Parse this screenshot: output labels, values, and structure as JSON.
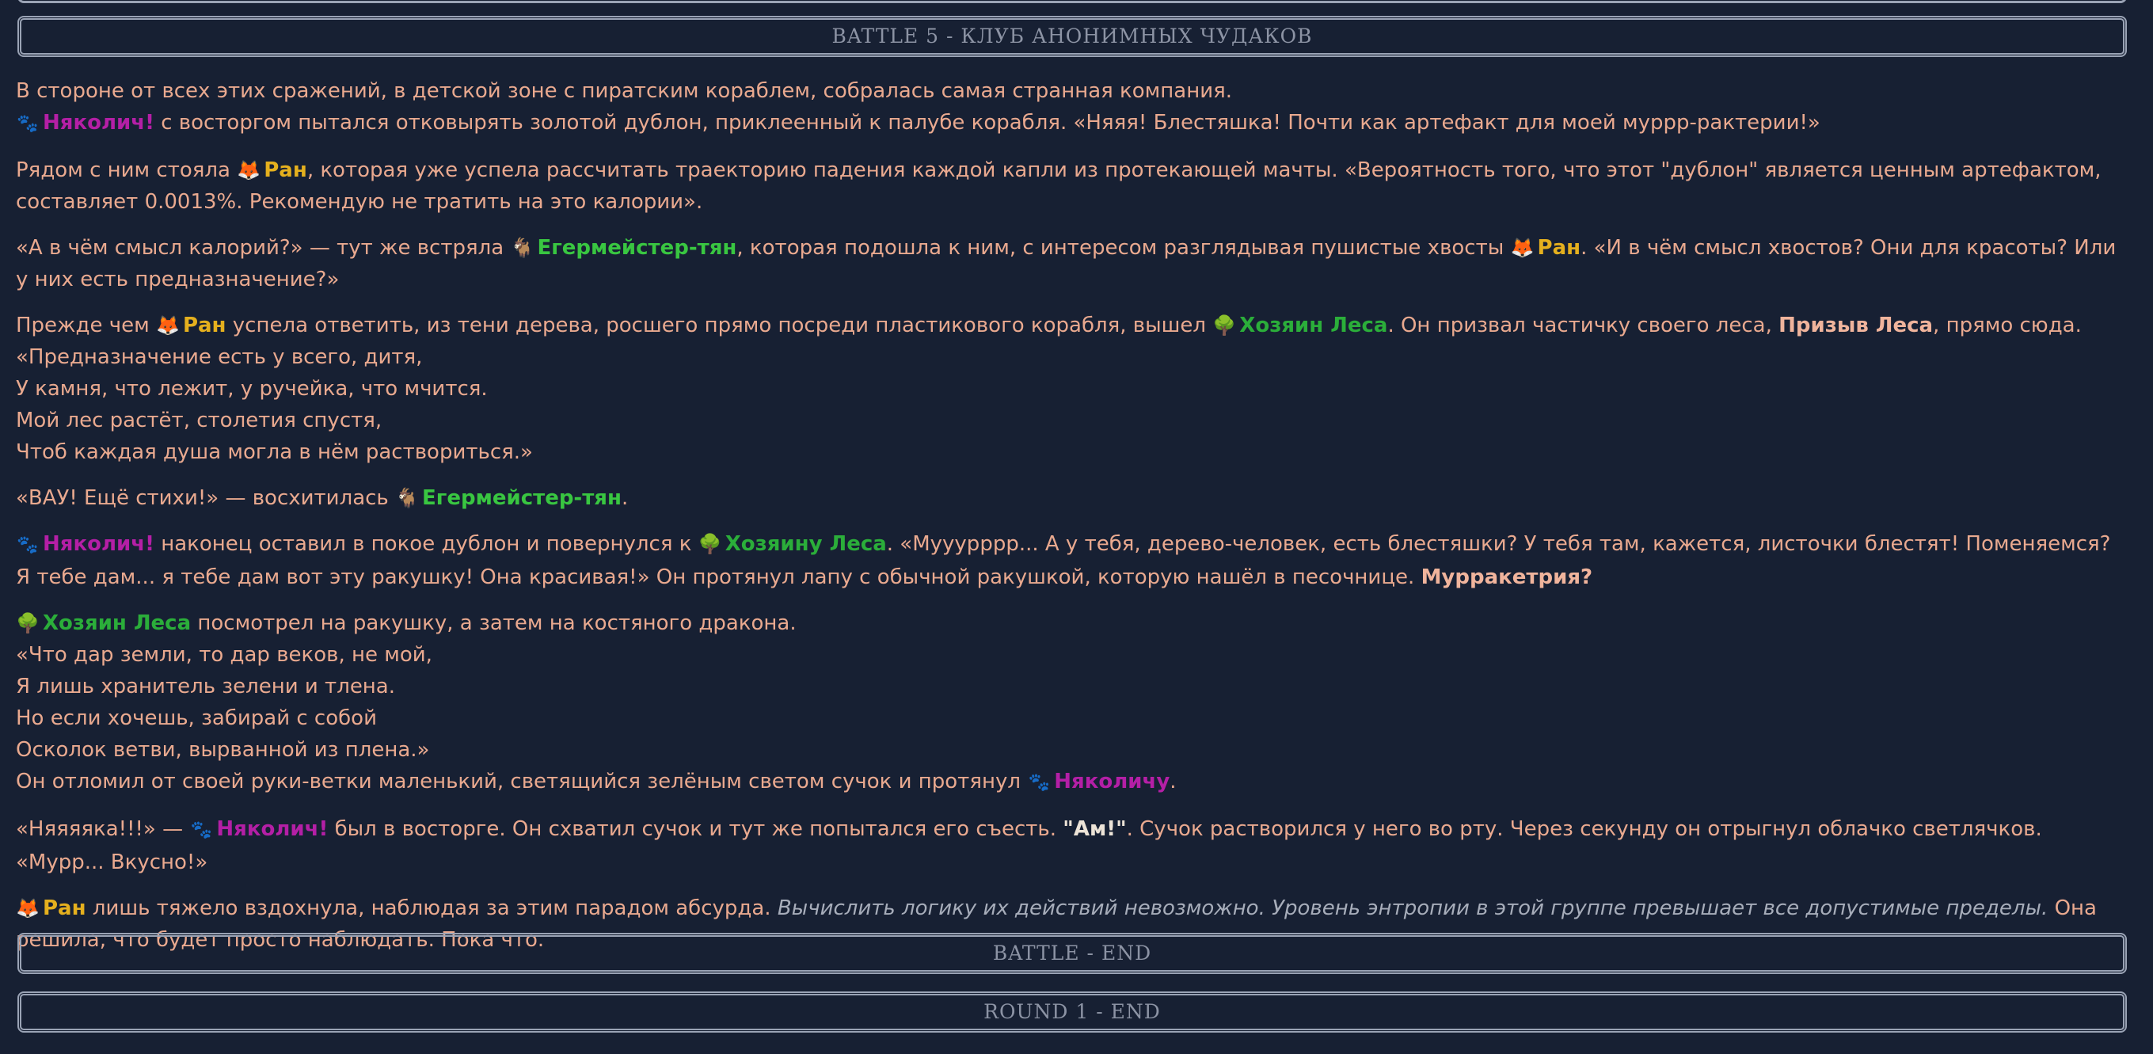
{
  "banners": {
    "battle_title": "BATTLE 5 - КЛУБ АНОНИМНЫХ ЧУДАКОВ",
    "battle_end": "BATTLE - END",
    "round_end": "ROUND 1 - END"
  },
  "names": {
    "nyakolich": "Няколич!",
    "nyakolichu": "Няколичу",
    "ran": "Ран",
    "egermeister": "Егермейстер-тян",
    "forest_master": "Хозяин Леса",
    "forest_master_dat": "Хозяину Леса"
  },
  "icons": {
    "paw": "paw-icon",
    "fox": "fox-icon",
    "goat": "goat-icon",
    "tree": "tree-icon"
  },
  "colors": {
    "background": "#172033",
    "narration": "#e9a98f",
    "nyakolich": "#b41fa6",
    "ran": "#e5b01e",
    "egermeister": "#39c641",
    "forest_master": "#2bae3a"
  },
  "story": {
    "p1_line1": "В стороне от всех этих сражений, в детской зоне с пиратским кораблем, собралась самая странная компания.",
    "p1_line2_after": " с восторгом пытался отковырять золотой дублон, приклеенный к палубе корабля. «Няяя! Блестяшка! Почти как артефакт для моей муррр-рактерии!»",
    "p2_before": "Рядом с ним стояла ",
    "p2_after": ", которая уже успела рассчитать траекторию падения каждой капли из протекающей мачты. «Вероятность того, что этот \"дублон\" является ценным артефактом, составляет 0.0013%. Рекомендую не тратить на это калории».",
    "p3_before": "«А в чём смысл калорий?» — тут же встряла ",
    "p3_middle": ", которая подошла к ним, с интересом разглядывая пушистые хвосты ",
    "p3_after": ". «И в чём смысл хвостов? Они для красоты? Или у них есть предназначение?»",
    "p4_before": "Прежде чем ",
    "p4_middle": " успела ответить, из тени дерева, росшего прямо посреди пластикового корабля, вышел ",
    "p4_after": ". Он призвал частичку своего леса, ",
    "p4_skill": "Призыв Леса",
    "p4_end": ", прямо сюда.",
    "poem1": [
      "«Предназначение есть у всего, дитя,",
      "У камня, что лежит, у ручейка, что мчится.",
      "Мой лес растёт, столетия спустя,",
      "Чтоб каждая душа могла в нём раствориться.»"
    ],
    "p5_before": "«ВАУ! Ещё стихи!» — восхитилась ",
    "p5_after": ".",
    "p6_middle": " наконец оставил в покое дублон и повернулся к ",
    "p6_after": ". «Мууурррр... А у тебя, дерево-человек, есть блестяшки? У тебя там, кажется, листочки блестят! Поменяемся? Я тебе дам... я тебе дам вот эту ракушку! Она красивая!» Он протянул лапу с обычной ракушкой, которую нашёл в песочнице. ",
    "p6_skill": "Мурракетрия?",
    "p7_after": " посмотрел на ракушку, а затем на костяного дракона.",
    "poem2": [
      "«Что дар земли, то дар веков, не мой,",
      "Я лишь хранитель зелени и тлена.",
      "Но если хочешь, забирай с собой",
      "Осколок ветви, вырванной из плена.»"
    ],
    "p7_last_before": "Он отломил от своей руки-ветки маленький, светящийся зелёным светом сучок и протянул ",
    "p7_last_after": ".",
    "p8_before": "«Няяяяка!!!» — ",
    "p8_middle": " был в восторге. Он схватил сучок и тут же попытался его съесть. ",
    "p8_quote": "\"Ам!\"",
    "p8_after": ". Сучок растворился у него во рту. Через секунду он отрыгнул облачко светлячков. «Мурр... Вкусно!»",
    "p9_after": " лишь тяжело вздохнула, наблюдая за этим парадом абсурда. ",
    "p9_thought": "Вычислить логику их действий невозможно. Уровень энтропии в этой группе превышает все допустимые пределы.",
    "p9_end": " Она решила, что будет просто наблюдать. Пока что."
  }
}
